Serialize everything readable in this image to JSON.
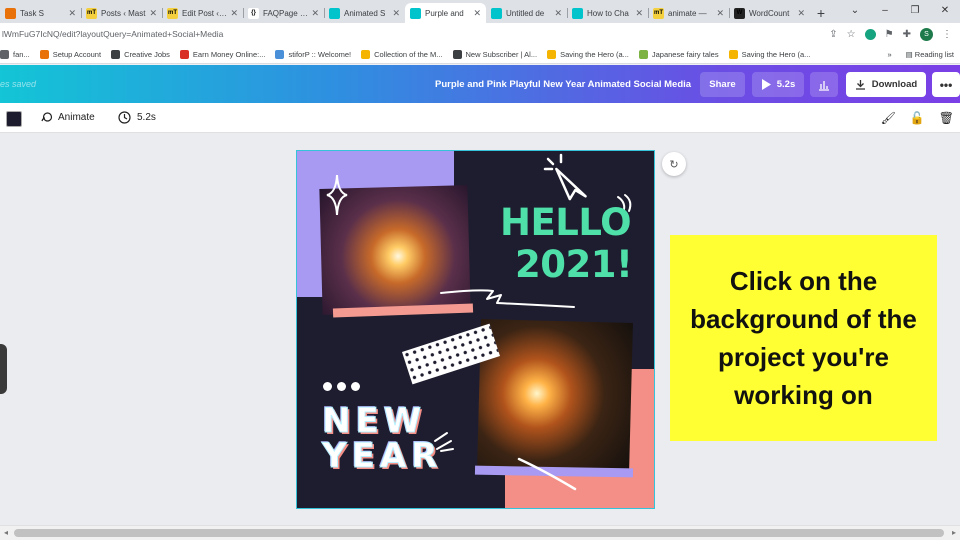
{
  "browser": {
    "tabs": [
      {
        "title": "Task S",
        "favicon_color": "#e8710a",
        "favicon_text": "",
        "active": false
      },
      {
        "title": "Posts ‹ Mast",
        "favicon_color": "#f4d03f",
        "favicon_text": "mT",
        "active": false
      },
      {
        "title": "Edit Post ‹ M",
        "favicon_color": "#f4d03f",
        "favicon_text": "mT",
        "active": false
      },
      {
        "title": "FAQPage JS",
        "favicon_color": "#ffffff",
        "favicon_text": "{}",
        "active": false
      },
      {
        "title": "Animated S",
        "favicon_color": "#00c4cc",
        "favicon_text": "",
        "active": false
      },
      {
        "title": "Purple and",
        "favicon_color": "#00c4cc",
        "favicon_text": "",
        "active": true
      },
      {
        "title": "Untitled de",
        "favicon_color": "#00c4cc",
        "favicon_text": "",
        "active": false
      },
      {
        "title": "How to Cha",
        "favicon_color": "#00c4cc",
        "favicon_text": "",
        "active": false
      },
      {
        "title": "animate — ",
        "favicon_color": "#f4d03f",
        "favicon_text": "mT",
        "active": false
      },
      {
        "title": "WordCount",
        "favicon_color": "#222222",
        "favicon_text": "W",
        "active": false
      }
    ],
    "new_tab_label": "+",
    "window_controls": [
      "⌄",
      "–",
      "❐",
      "✕"
    ],
    "url": "lWmFuG7IcNQ/edit?layoutQuery=Animated+Social+Media",
    "bookmarks": [
      {
        "label": "fan...",
        "color": "#5f6368"
      },
      {
        "label": "Setup Account",
        "color": "#e8710a"
      },
      {
        "label": "Creative Jobs",
        "color": "#3c4043"
      },
      {
        "label": "Earn Money Online:...",
        "color": "#d93025"
      },
      {
        "label": "stiforP :: Welcome!",
        "color": "#4a90d9"
      },
      {
        "label": "Collection of the M...",
        "color": "#f4b400"
      },
      {
        "label": "New Subscriber | Al...",
        "color": "#3c4043"
      },
      {
        "label": "Saving the Hero (a...",
        "color": "#f4b400"
      },
      {
        "label": "Japanese fairy tales",
        "color": "#7cb342"
      },
      {
        "label": "Saving the Hero (a...",
        "color": "#f4b400"
      }
    ],
    "bookmarks_more": "»",
    "reading_list": "Reading list",
    "profile_initial": "S"
  },
  "editor": {
    "saved_status": "es saved",
    "design_title": "Purple and Pink Playful New Year Animated Social Media",
    "share_label": "Share",
    "play_duration": "5.2s",
    "download_label": "Download",
    "more_label": "•••",
    "animate_label": "Animate",
    "timing_label": "5.2s",
    "swatch_color": "#1c1c2e"
  },
  "design": {
    "hello_text": "HELLO",
    "year_text": "2021!",
    "new_text": "NEW",
    "year_word": "YEAR",
    "accent_green": "#4ee0a8",
    "purple": "#a89af3",
    "pink": "#f38f86",
    "background": "#1e1d2f"
  },
  "callout": {
    "text": "Click on the background of the project you're working on",
    "background": "#ffff33"
  }
}
